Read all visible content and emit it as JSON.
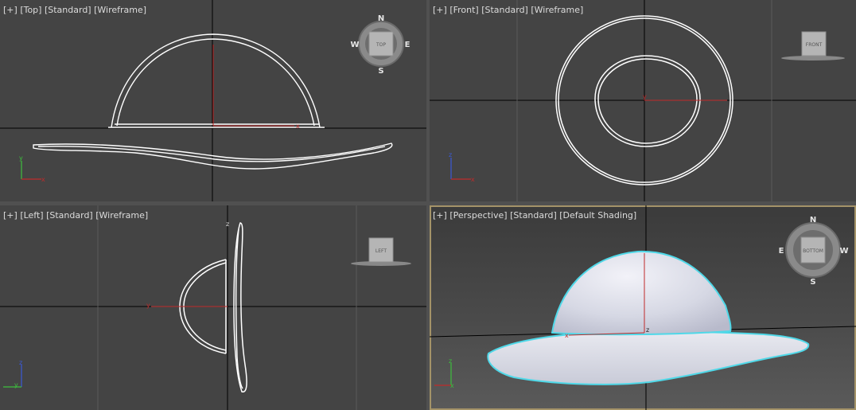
{
  "viewports": {
    "top": {
      "label_menu": "[+]",
      "label_view": "[Top]",
      "label_shading_mode": "[Standard]",
      "label_display": "[Wireframe]",
      "viewcube_label": "TOP",
      "compass": {
        "north": "N",
        "south": "S",
        "east": "E",
        "west": "W"
      },
      "triad": {
        "x": "x",
        "y": "y"
      }
    },
    "front": {
      "label_menu": "[+]",
      "label_view": "[Front]",
      "label_shading_mode": "[Standard]",
      "label_display": "[Wireframe]",
      "viewcube_label": "FRONT",
      "triad": {
        "x": "x",
        "z": "z"
      }
    },
    "left": {
      "label_menu": "[+]",
      "label_view": "[Left]",
      "label_shading_mode": "[Standard]",
      "label_display": "[Wireframe]",
      "viewcube_label": "LEFT",
      "triad": {
        "y": "y",
        "z": "z"
      }
    },
    "perspective": {
      "label_menu": "[+]",
      "label_view": "[Perspective]",
      "label_shading_mode": "[Standard]",
      "label_display": "[Default Shading]",
      "viewcube_label": "BOTTOM",
      "compass": {
        "north": "N",
        "south": "S",
        "east": "E",
        "west": "W"
      },
      "triad": {
        "x": "x",
        "z": "z"
      }
    }
  },
  "colors": {
    "viewport_bg": "#444444",
    "wire": "#ffffff",
    "selection_highlight": "#4fd8e8",
    "active_border": "#a49368",
    "axis_x": "#c02a2a",
    "axis_y": "#3dbf3d",
    "axis_z": "#3a5ad8",
    "grid_line": "#000000"
  }
}
